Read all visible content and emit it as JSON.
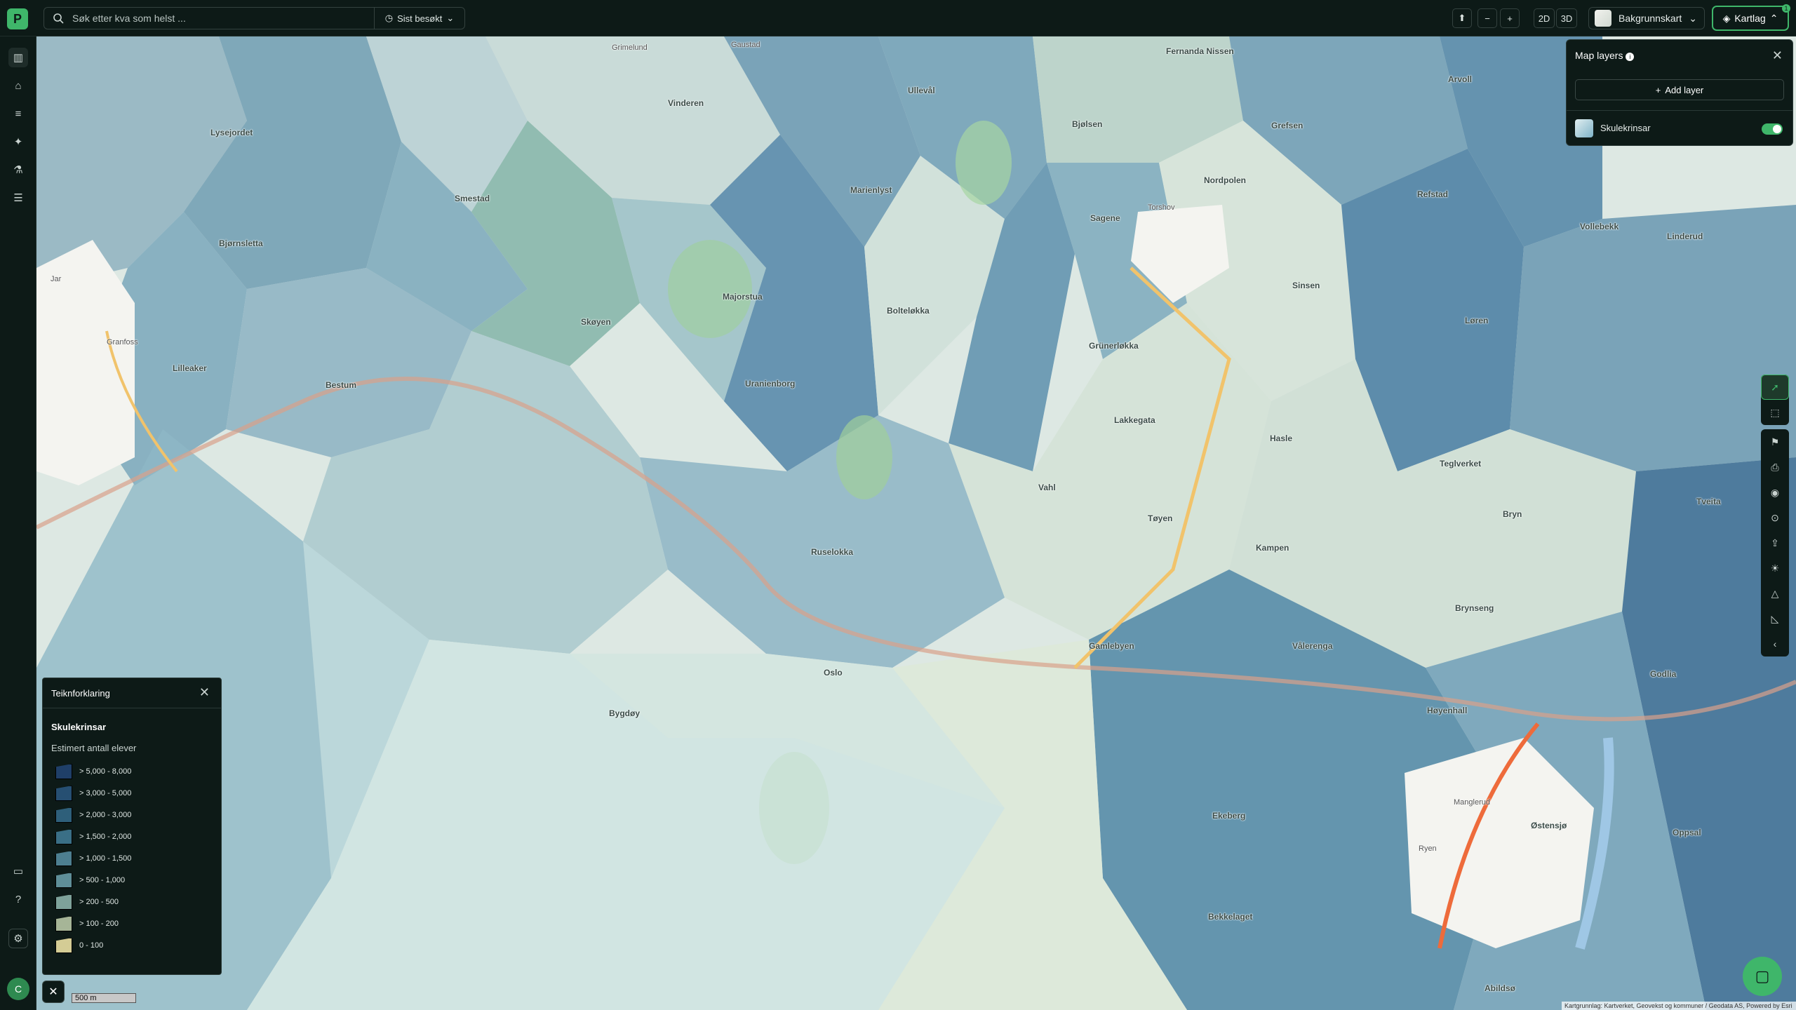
{
  "topbar": {
    "search_placeholder": "Søk etter kva som helst ...",
    "recent_label": "Sist besøkt",
    "btn_2d": "2D",
    "btn_3d": "3D",
    "zoom_out": "−",
    "zoom_in": "+",
    "basemap_label": "Bakgrunnskart",
    "layers_label": "Kartlag",
    "layers_badge": "1",
    "logo_letter": "P"
  },
  "sidebar": {
    "avatar_initial": "C",
    "icons": [
      "map-icon",
      "tag-icon",
      "list-icon",
      "sparkle-icon",
      "flask-icon",
      "filter-icon",
      "comment-icon",
      "help-icon",
      "settings-icon"
    ]
  },
  "layers_panel": {
    "title": "Map layers",
    "add_label": "Add layer",
    "layer_name": "Skulekrinsar",
    "layer_enabled": true
  },
  "legend": {
    "title": "Teiknforklaring",
    "layer": "Skulekrinsar",
    "subtitle": "Estimert antall elever",
    "items": [
      {
        "label": "> 5,000 - 8,000",
        "color": "#1f3f68"
      },
      {
        "label": "> 3,000 - 5,000",
        "color": "#264f72"
      },
      {
        "label": "> 2,000 - 3,000",
        "color": "#2e5f7a"
      },
      {
        "label": "> 1,500 - 2,000",
        "color": "#3a6f86"
      },
      {
        "label": "> 1,000 - 1,500",
        "color": "#4d7f90"
      },
      {
        "label": "> 500 - 1,000",
        "color": "#5f8f98"
      },
      {
        "label": "> 200 - 500",
        "color": "#7ea29a"
      },
      {
        "label": "> 100 - 200",
        "color": "#a6b597"
      },
      {
        "label": "0 - 100",
        "color": "#d4cc95"
      }
    ]
  },
  "map": {
    "scale_label": "500 m",
    "attribution": "Kartgrunnlag: Kartverket, Geovekst og kommuner / Geodata AS, Powered by Esri",
    "places": [
      {
        "name": "Fernanda Nissen",
        "small": false
      },
      {
        "name": "Grefsen",
        "small": false
      },
      {
        "name": "Arvoll",
        "small": false
      },
      {
        "name": "Grimelund",
        "small": true
      },
      {
        "name": "Gaustad",
        "small": true
      },
      {
        "name": "Vinderen",
        "small": false
      },
      {
        "name": "Ullevål",
        "small": false
      },
      {
        "name": "Bjølsen",
        "small": false
      },
      {
        "name": "Lysejordet",
        "small": false
      },
      {
        "name": "Smestad",
        "small": false
      },
      {
        "name": "Marienlyst",
        "small": false
      },
      {
        "name": "Nordpolen",
        "small": false
      },
      {
        "name": "Refstad",
        "small": false
      },
      {
        "name": "Torshov",
        "small": true
      },
      {
        "name": "Sagene",
        "small": false
      },
      {
        "name": "Vollebekk",
        "small": false
      },
      {
        "name": "Linderud",
        "small": false
      },
      {
        "name": "Bjørnsletta",
        "small": false
      },
      {
        "name": "Sinsen",
        "small": false
      },
      {
        "name": "Majorstua",
        "small": false
      },
      {
        "name": "Bolteløkka",
        "small": false
      },
      {
        "name": "Skøyen",
        "small": false
      },
      {
        "name": "Granfoss",
        "small": true
      },
      {
        "name": "Lilleaker",
        "small": false
      },
      {
        "name": "Grünerløkka",
        "small": false
      },
      {
        "name": "Løren",
        "small": false
      },
      {
        "name": "Bestum",
        "small": false
      },
      {
        "name": "Uranienborg",
        "small": false
      },
      {
        "name": "Lakkegata",
        "small": false
      },
      {
        "name": "Hasle",
        "small": false
      },
      {
        "name": "Tøyen",
        "small": false
      },
      {
        "name": "Vahl",
        "small": false
      },
      {
        "name": "Teglverket",
        "small": false
      },
      {
        "name": "Bryn",
        "small": false
      },
      {
        "name": "Tveita",
        "small": false
      },
      {
        "name": "Kampen",
        "small": false
      },
      {
        "name": "Ruselokka",
        "small": false
      },
      {
        "name": "Brynseng",
        "small": false
      },
      {
        "name": "Gamlebyen",
        "small": false
      },
      {
        "name": "Vålerenga",
        "small": false
      },
      {
        "name": "Oslo",
        "small": false
      },
      {
        "name": "Godlia",
        "small": false
      },
      {
        "name": "Bygdøy",
        "small": false
      },
      {
        "name": "Høyenhall",
        "small": false
      },
      {
        "name": "Manglerud",
        "small": true
      },
      {
        "name": "Ekeberg",
        "small": false
      },
      {
        "name": "Ryen",
        "small": true
      },
      {
        "name": "Østensjø",
        "small": false
      },
      {
        "name": "Oppsal",
        "small": false
      },
      {
        "name": "Bekkelaget",
        "small": false
      },
      {
        "name": "Abildsø",
        "small": false
      },
      {
        "name": "Jar",
        "small": true
      }
    ]
  }
}
